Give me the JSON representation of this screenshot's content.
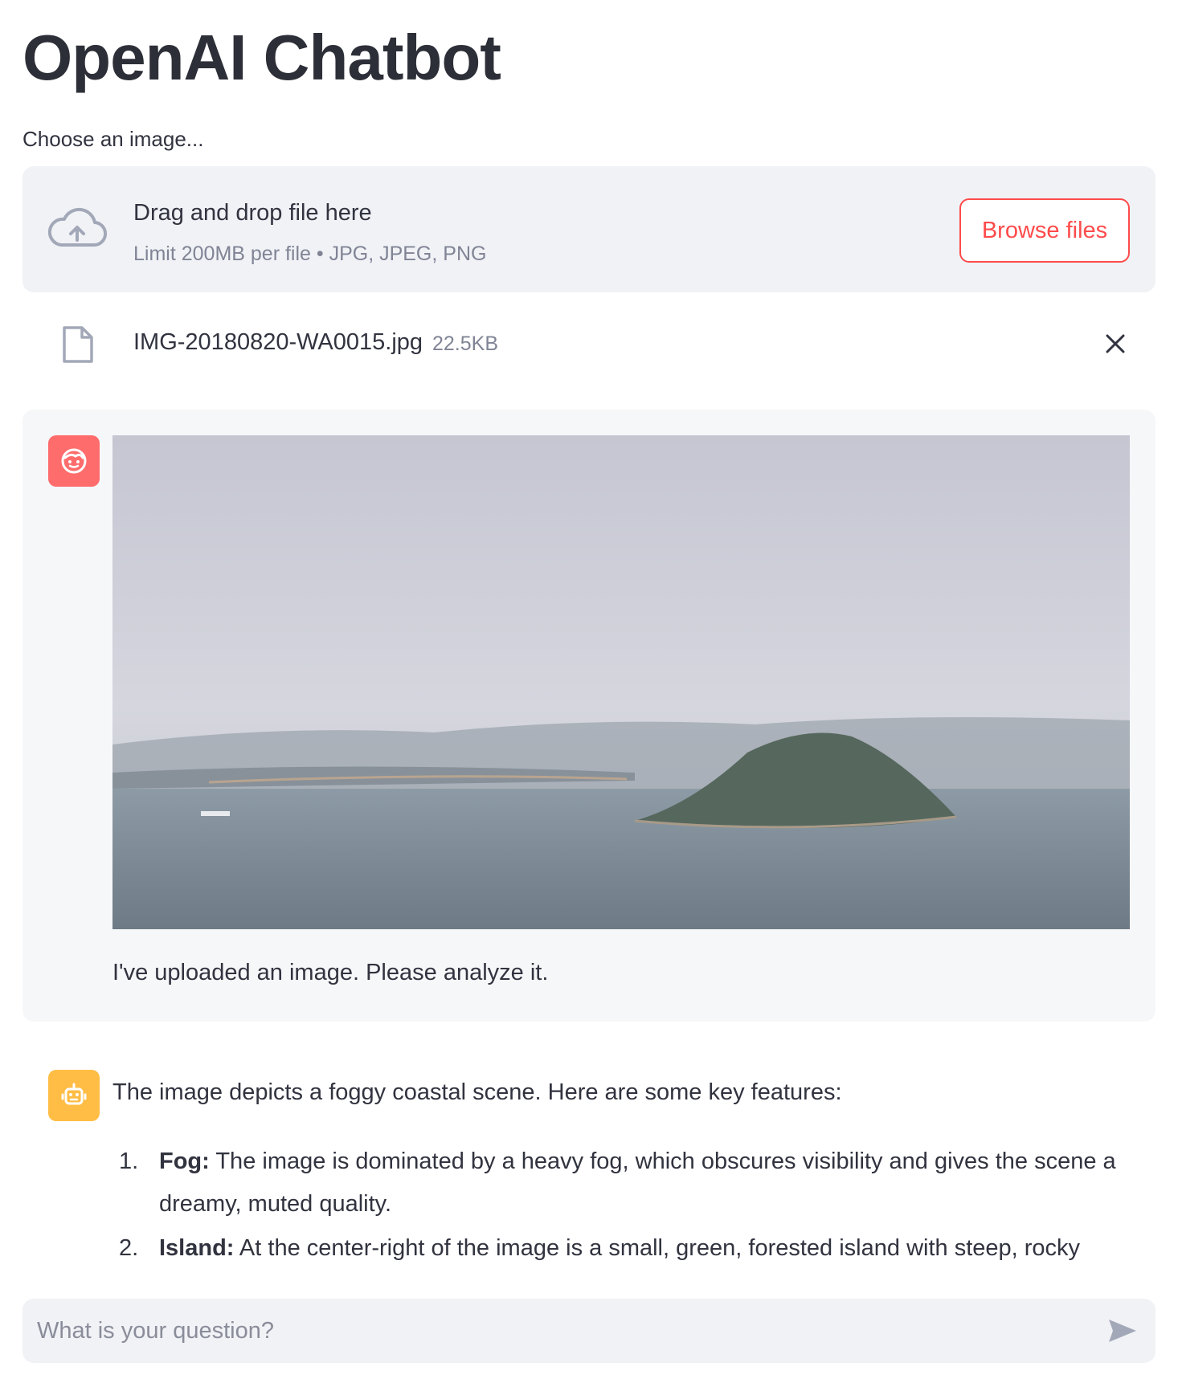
{
  "header": {
    "title": "OpenAI Chatbot"
  },
  "uploader": {
    "label": "Choose an image...",
    "drop_title": "Drag and drop file here",
    "drop_subtitle": "Limit 200MB per file • JPG, JPEG, PNG",
    "browse_label": "Browse files",
    "icon": "cloud-upload-icon"
  },
  "uploaded_file": {
    "name": "IMG-20180820-WA0015.jpg",
    "size": "22.5KB",
    "icon": "file-icon",
    "remove_icon": "close-icon"
  },
  "messages": {
    "user": {
      "avatar_icon": "user-face-icon",
      "avatar_color": "#ff6c6c",
      "text": "I've uploaded an image. Please analyze it."
    },
    "assistant": {
      "avatar_icon": "robot-icon",
      "avatar_color": "#ffbd45",
      "intro": "The image depicts a foggy coastal scene. Here are some key features:",
      "items": [
        {
          "number": "1.",
          "label": "Fog:",
          "text": " The image is dominated by a heavy fog, which obscures visibility and gives the scene a dreamy, muted quality."
        },
        {
          "number": "2.",
          "label": "Island:",
          "text": " At the center-right of the image is a small, green, forested island with steep, rocky"
        }
      ]
    }
  },
  "chat_input": {
    "placeholder": "What is your question?",
    "send_icon": "send-icon"
  },
  "colors": {
    "accent": "#ff4b4b",
    "panel_bg": "#f0f2f6",
    "message_bg": "#f6f7f9"
  }
}
